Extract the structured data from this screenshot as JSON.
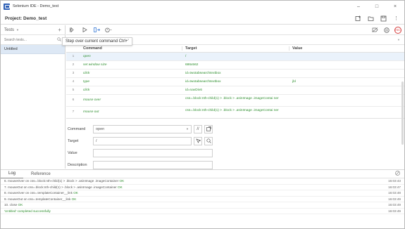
{
  "window": {
    "title": "Selenium IDE - Demo_test",
    "buttons": {
      "minimize": "–",
      "maximize": "□",
      "close": "×"
    }
  },
  "project": {
    "label": "Project:",
    "name": "Demo_test"
  },
  "sidebar": {
    "header": "Tests",
    "add": "+",
    "search_placeholder": "Search tests...",
    "tests": [
      "Untitled"
    ]
  },
  "toolbar": {
    "tooltip": "Step over current command  Ctrl+'"
  },
  "table": {
    "headers": {
      "command": "Command",
      "target": "Target",
      "value": "Value"
    },
    "rows": [
      {
        "num": "1",
        "command": "open",
        "target": "/",
        "value": ""
      },
      {
        "num": "2",
        "command": "set window size",
        "target": "686x562",
        "value": ""
      },
      {
        "num": "3",
        "command": "click",
        "target": "id=twotabsearchtextbox",
        "value": ""
      },
      {
        "num": "4",
        "command": "type",
        "target": "id=twotabsearchtextbox",
        "value": "jbl"
      },
      {
        "num": "5",
        "command": "click",
        "target": "id=navDiv6",
        "value": ""
      },
      {
        "num": "6",
        "command": "mouse over",
        "target": "css=.block:nth-child(1) > .block > .asinImage .imageContai ner",
        "value": ""
      },
      {
        "num": "7",
        "command": "mouse out",
        "target": "css=.block:nth-child(1) > .block > .asinImage .imageContai ner",
        "value": ""
      }
    ]
  },
  "editor": {
    "command_label": "Command",
    "command_value": "open",
    "target_label": "Target",
    "target_value": "/",
    "value_label": "Value",
    "value_value": "",
    "description_label": "Description",
    "description_value": ""
  },
  "log": {
    "tabs": [
      "Log",
      "Reference"
    ],
    "lines": [
      {
        "msg": "6.  mouseOver on css=.block:nth-child(1) > .block > .asinImage .imageContainer",
        "ok": "OK",
        "time": "16:03:43"
      },
      {
        "msg": "7.  mouseOut on css=.block:nth-child(1) > .block > .asinImage .imageContainer",
        "ok": "OK",
        "time": "16:03:47"
      },
      {
        "msg": "8.  mouseOver on css=.templateContainer__link",
        "ok": "OK",
        "time": "16:03:48"
      },
      {
        "msg": "9.  mouseOut on css=.templateContainer__link",
        "ok": "OK",
        "time": "16:03:49"
      },
      {
        "msg": "10. close",
        "ok": "OK",
        "time": "16:03:49"
      }
    ],
    "success": {
      "msg": "'Untitled' completed successfully",
      "time": "16:03:49"
    }
  },
  "colors": {
    "accent": "#2d5fb5",
    "command_green": "#2f8f2f",
    "record_red": "#d53b3b",
    "selected_test_bg": "#dde8f5"
  }
}
